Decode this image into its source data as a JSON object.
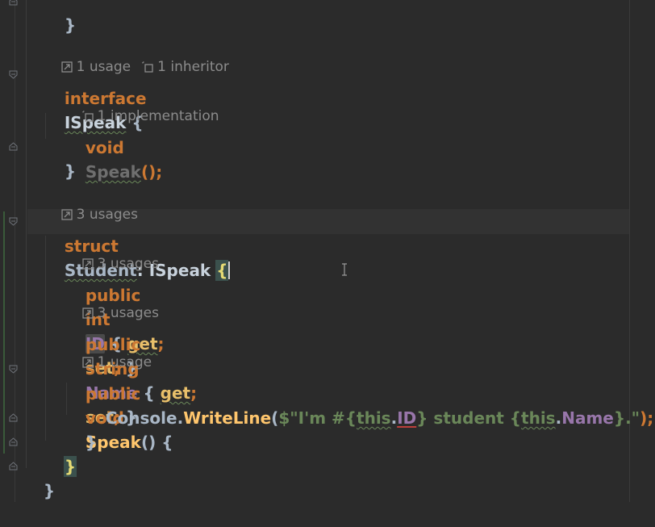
{
  "editor": {
    "lines": {
      "top_brace": "}",
      "hint1_usage": "1 usage",
      "hint1_inheritor": "1 inheritor",
      "kw_interface": "interface",
      "iface_name": "ISpeak",
      "open_brace": " {",
      "hint2_impl": "1 implementation",
      "kw_void": "void",
      "method_speak": "Speak",
      "parens_semi": "();",
      "close_brace": "}",
      "hint3_usages": "3 usages",
      "kw_struct": "struct",
      "struct_name": "Student",
      "colon_iface": ": ISpeak ",
      "struct_open_brace": "{",
      "hint4_usages": "3 usages",
      "kw_public": "public",
      "kw_int": "int",
      "prop_id": "ID",
      "get_set_open": " { ",
      "acc_get": "get",
      "acc_set": "set",
      "semi": ";",
      "get_set_close": " }",
      "hint5_usages": "3 usages",
      "kw_string": "string",
      "prop_name": "Name",
      "hint6_usage": "1 usage",
      "method_speak_decl": "Speak",
      "method_parens": "() {",
      "console": "Console",
      "dot": ".",
      "writeline": "WriteLine",
      "open_paren": "(",
      "str_prefix": "$\"I'm #{",
      "kw_this": "this",
      "str_mid": "} student {",
      "str_end": "}.\"",
      "close_call": ");",
      "inner_close": "}",
      "struct_close": "}",
      "outer_close": "}"
    },
    "icons": {
      "usage_icon": "arrow-box-icon",
      "inheritor_icon": "hierarchy-icon",
      "fold_icon": "fold-marker-icon"
    },
    "colors": {
      "keyword": "#cc7832",
      "property": "#9876aa",
      "method": "#ffc66d",
      "string": "#6a8759",
      "background": "#2b2b2b"
    }
  }
}
